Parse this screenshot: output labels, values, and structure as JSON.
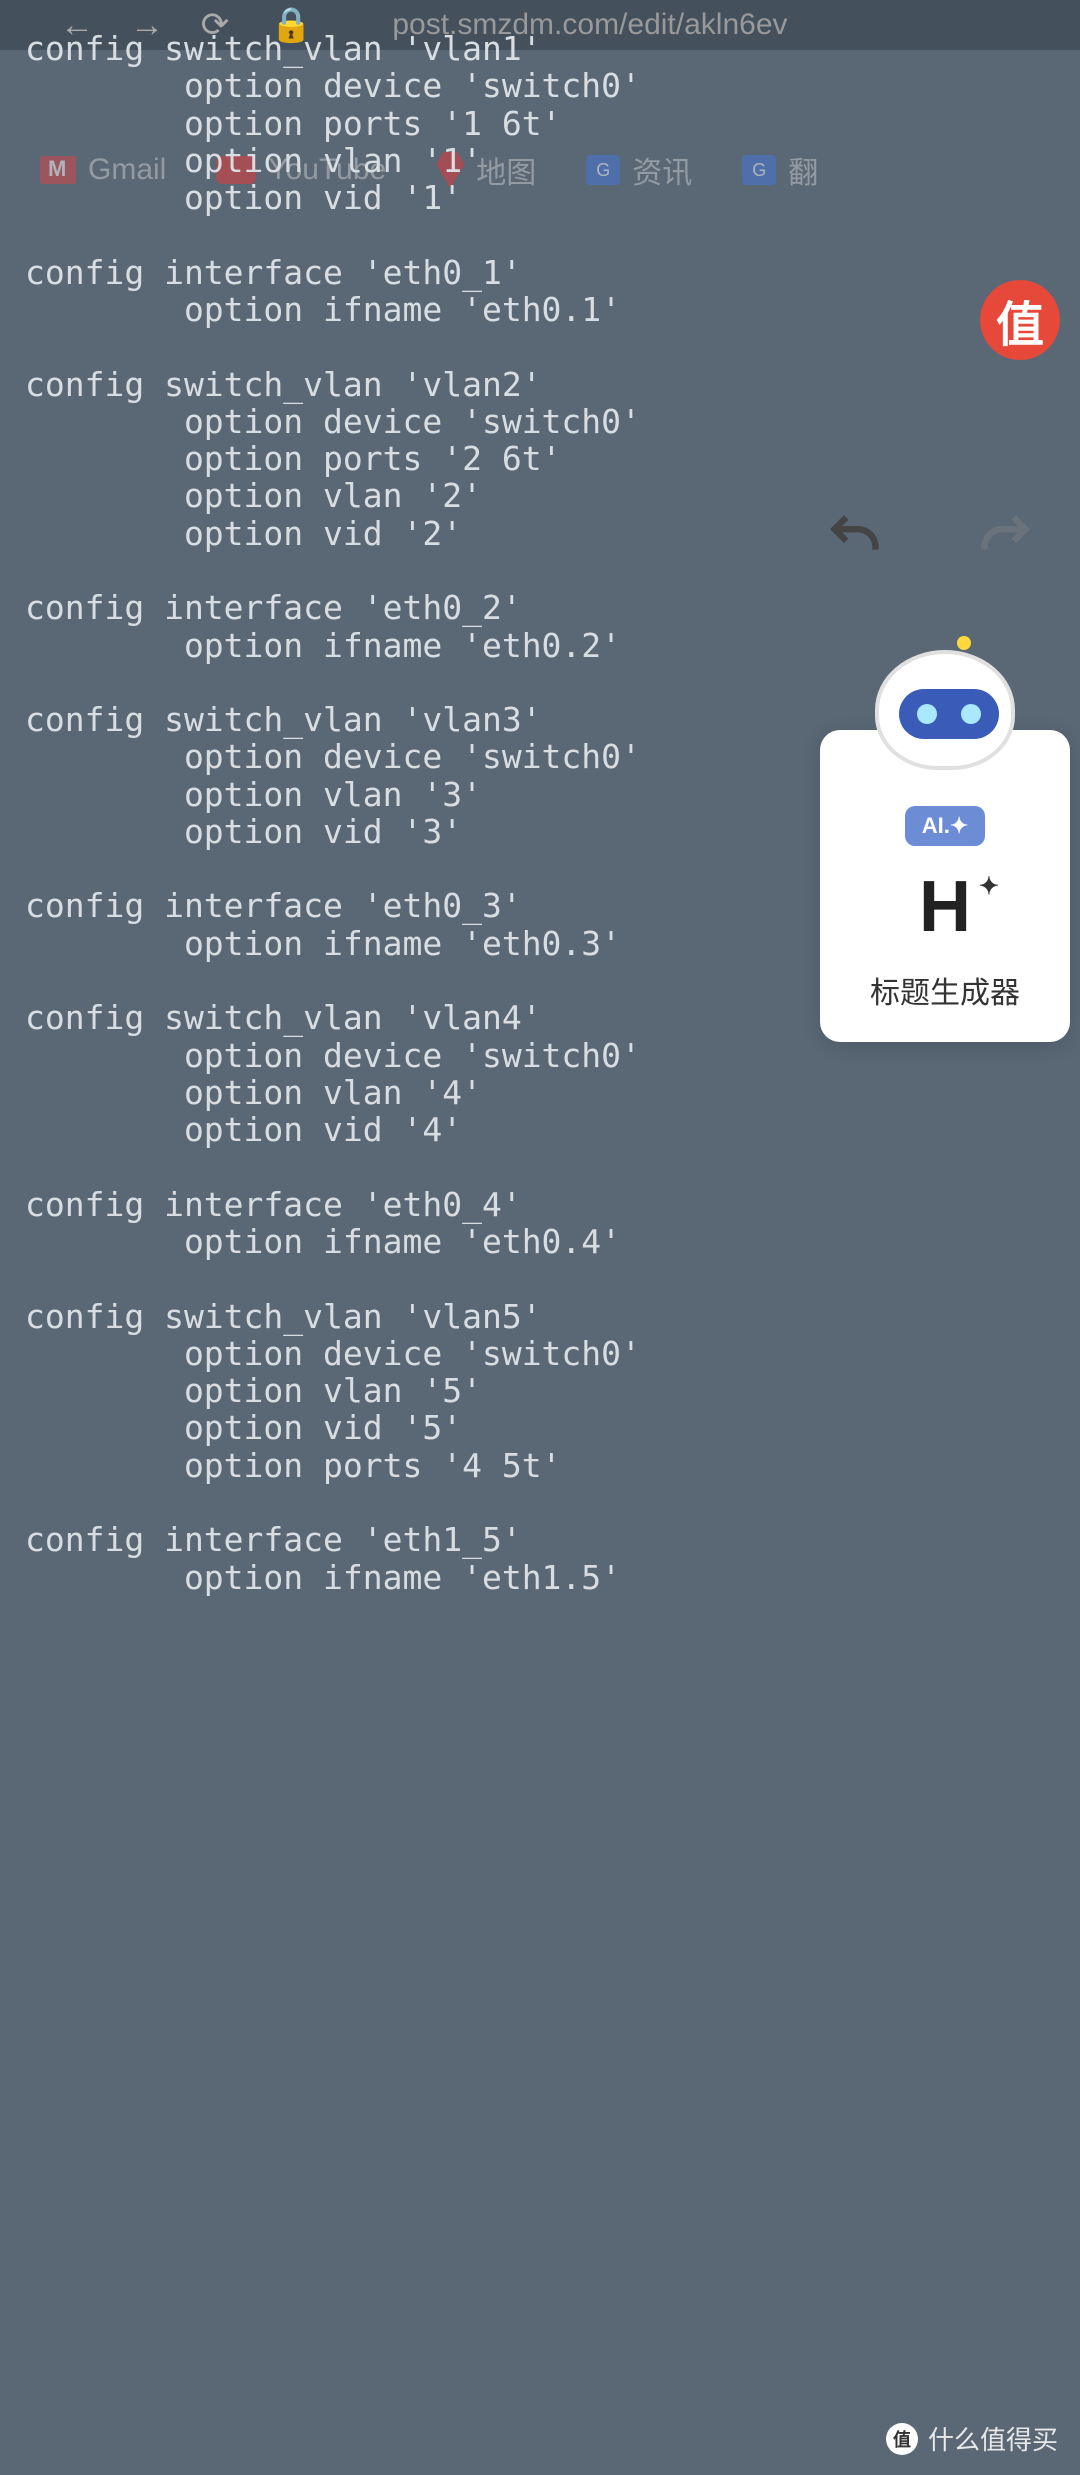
{
  "browser": {
    "url": "post.smzdm.com/edit/akln6ev"
  },
  "bookmarks": {
    "gmail": "Gmail",
    "youtube": "YouTube",
    "maps": "地图",
    "gtrans_short": "G",
    "news": "资讯",
    "translate": "翻"
  },
  "zhi_badge": "值",
  "ai_panel": {
    "badge": "AI.✦",
    "symbol": "H",
    "label": "标题生成器"
  },
  "code_lines": [
    "config switch_vlan 'vlan1'",
    "        option device 'switch0'",
    "        option ports '1 6t'",
    "        option vlan '1'",
    "        option vid '1'",
    "",
    "config interface 'eth0_1'",
    "        option ifname 'eth0.1'",
    "",
    "config switch_vlan 'vlan2'",
    "        option device 'switch0'",
    "        option ports '2 6t'",
    "        option vlan '2'",
    "        option vid '2'",
    "",
    "config interface 'eth0_2'",
    "        option ifname 'eth0.2'",
    "",
    "config switch_vlan 'vlan3'",
    "        option device 'switch0'",
    "        option vlan '3'",
    "        option vid '3'",
    "",
    "config interface 'eth0_3'",
    "        option ifname 'eth0.3'",
    "",
    "config switch_vlan 'vlan4'",
    "        option device 'switch0'",
    "        option vlan '4'",
    "        option vid '4'",
    "",
    "config interface 'eth0_4'",
    "        option ifname 'eth0.4'",
    "",
    "config switch_vlan 'vlan5'",
    "        option device 'switch0'",
    "        option vlan '5'",
    "        option vid '5'",
    "        option ports '4 5t'",
    "",
    "config interface 'eth1_5'",
    "        option ifname 'eth1.5'"
  ],
  "watermark": {
    "badge": "值",
    "text": "什么值得买"
  }
}
